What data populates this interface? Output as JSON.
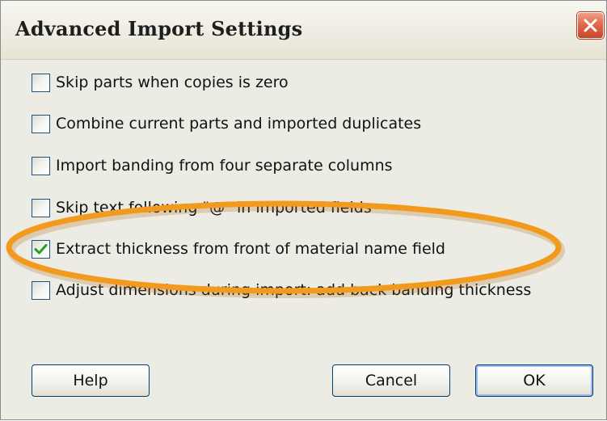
{
  "window": {
    "title": "Advanced Import Settings"
  },
  "options": [
    {
      "label": "Skip parts when copies is zero",
      "checked": false
    },
    {
      "label": "Combine current parts and imported duplicates",
      "checked": false
    },
    {
      "label": "Import banding from four separate columns",
      "checked": false
    },
    {
      "label": "Skip text following \"@\" in imported fields",
      "checked": false
    },
    {
      "label": "Extract thickness from front of material name field",
      "checked": true
    },
    {
      "label": "Adjust dimensions during import: add back banding thickness",
      "checked": false
    }
  ],
  "buttons": {
    "help": "Help",
    "cancel": "Cancel",
    "ok": "OK"
  },
  "icons": {
    "close": "close-icon",
    "check": "checkmark-icon"
  },
  "colors": {
    "close_button": "#d9573a",
    "checkmark": "#21a121",
    "highlight": "#f29a1e"
  }
}
